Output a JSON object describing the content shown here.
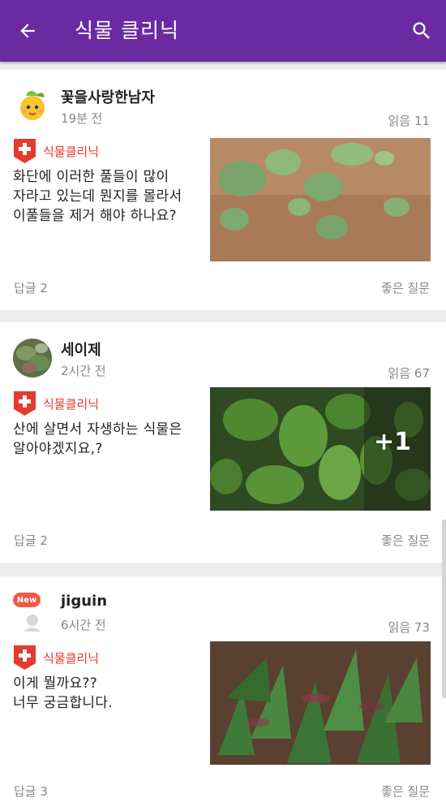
{
  "appbar": {
    "title": "식물 클리닉"
  },
  "posts": [
    {
      "username": "꽃을사랑한남자",
      "time": "19분 전",
      "reads": "읽음 11",
      "category": "식물클리닉",
      "question": "화단에 이러한 풀들이 많이\n자라고 있는데 뭔지를 몰라서\n이풀들을 제거 해야 하나요?",
      "replies": "답글 2",
      "good": "좋은 질문"
    },
    {
      "username": "세이제",
      "time": "2시간 전",
      "reads": "읽음 67",
      "category": "식물클리닉",
      "question": "산에 살면서 자생하는 식물은\n알아야겠지요,?",
      "replies": "답글 2",
      "good": "좋은 질문",
      "more_photos": "+1"
    },
    {
      "username": "jiguin",
      "time": "6시간 전",
      "reads": "읽음 73",
      "category": "식물클리닉",
      "question": "이게 뭘까요??\n너무 궁금합니다.",
      "replies": "답글 3",
      "good": "좋은 질문",
      "new_label": "New"
    }
  ],
  "icons": {
    "back": "arrow-back-icon",
    "search": "search-icon",
    "category": "red-cross-badge-icon"
  },
  "colors": {
    "appbar": "#6a2aa1",
    "category": "#e53a2e",
    "new_badge": "#f05a45"
  }
}
